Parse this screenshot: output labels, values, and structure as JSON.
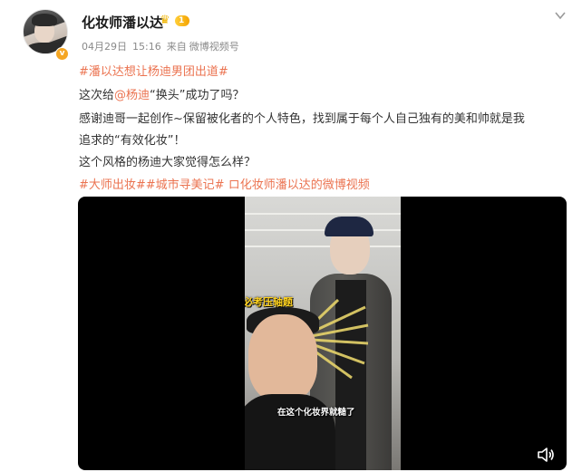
{
  "author": {
    "name": "化妆师潘以达",
    "verified_badge": "v",
    "vip_level": "1",
    "icons": {
      "avatar": "avatar-portrait",
      "crown": "crown-icon",
      "more": "chevron-down-icon"
    }
  },
  "meta": {
    "date": "04月29日",
    "time": "15:16",
    "source_prefix": "来自",
    "source": "微博视频号"
  },
  "post": {
    "hashtag_title": "#潘以达想让杨迪男团出道#",
    "line1_pre": "这次给",
    "line1_mention": "@杨迪",
    "line1_post": "“换头”成功了吗？",
    "line2": "感谢迪哥一起创作~保留被化者的个人特色，找到属于每个人自己独有的美和帅就是我",
    "line3": "追求的“有效化妆”！",
    "line4": "这个风格的杨迪大家觉得怎么样？",
    "tags_line": "#大师出妆##城市寻美记# ロ化妆师潘以达的微博视频"
  },
  "video": {
    "sticker_text": "必考压轴题",
    "subtitle": "在这个化妆界就糙了",
    "icons": {
      "volume": "volume-icon"
    }
  },
  "colors": {
    "accent": "#eb7350",
    "text": "#333333",
    "meta": "#8a8a8a",
    "vip": "#f4a300"
  }
}
